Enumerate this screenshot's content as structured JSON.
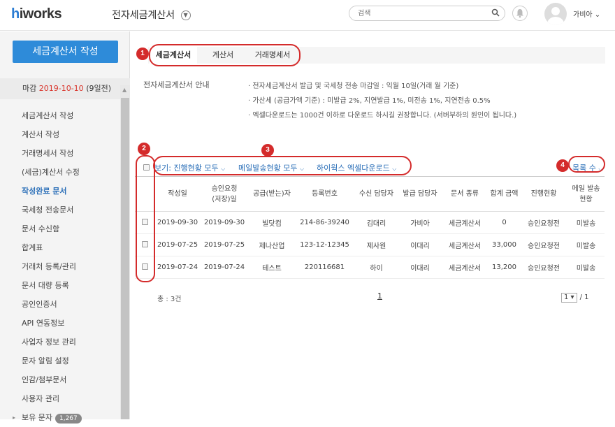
{
  "header": {
    "logo": "hiworks",
    "app_title": "전자세금계산서",
    "search_placeholder": "검색",
    "username": "가비아 ⌄"
  },
  "sidebar": {
    "compose_label": "세금계산서 작성",
    "deadline_prefix": "마감",
    "deadline_date": "2019-10-10",
    "deadline_suffix": "(9일전)",
    "items": [
      {
        "label": "세금계산서 작성"
      },
      {
        "label": "계산서 작성"
      },
      {
        "label": "거래명세서 작성"
      },
      {
        "label": "(세금)계산서 수정"
      },
      {
        "label": "작성완료 문서"
      },
      {
        "label": "국세청 전송문서"
      },
      {
        "label": "문서 수신함"
      },
      {
        "label": "합계표"
      },
      {
        "label": "거래처 등록/관리"
      },
      {
        "label": "문서 대량 등록"
      },
      {
        "label": "공인인증서"
      },
      {
        "label": "API 연동정보"
      },
      {
        "label": "사업자 정보 관리"
      },
      {
        "label": "문자 알림 설정"
      },
      {
        "label": "인감/첨부문서"
      },
      {
        "label": "사용자 관리"
      },
      {
        "label": "보유 문자",
        "badge": "1,267"
      }
    ]
  },
  "tabs": [
    "세금계산서",
    "계산서",
    "거래명세서"
  ],
  "info": {
    "label": "전자세금계산서 안내",
    "lines": [
      "· 전자세금계산서 발급 및 국세청 전송 마감일 : 익월 10일(거래 월 기준)",
      "· 가산세 (공급가액 기준) : 미발급 2%, 지연발급 1%, 미전송 1%, 지연전송 0.5%",
      "· 엑셀다운로드는 1000건 이하로 다운로드 하시길 권장합니다. (서버부하의 원인이 됩니다.)"
    ]
  },
  "filters": {
    "view": "보기: 진행현황 모두",
    "mail": "메일발송현황 모두",
    "excel": "하이웍스 엑셀다운로드",
    "list_count": "목록 수"
  },
  "table": {
    "headers": [
      "작성일",
      "승인요청\n(저장)일",
      "공급(받는)자",
      "등록번호",
      "수신 담당자",
      "발급 담당자",
      "문서 종류",
      "합계 금액",
      "진행현황",
      "메일 발송\n현황"
    ],
    "rows": [
      [
        "2019-09-30",
        "2019-09-30",
        "빌닷컴",
        "214-86-39240",
        "김대리",
        "가비아",
        "세금계산서",
        "0",
        "승인요청전",
        "미발송"
      ],
      [
        "2019-07-25",
        "2019-07-25",
        "제나산업",
        "123-12-12345",
        "제사원",
        "이대리",
        "세금계산서",
        "33,000",
        "승인요청전",
        "미발송"
      ],
      [
        "2019-07-24",
        "2019-07-24",
        "테스트",
        "220116681",
        "하이",
        "이대리",
        "세금계산서",
        "13,200",
        "승인요청전",
        "미발송"
      ]
    ]
  },
  "footer": {
    "total": "총 : 3건",
    "current_page": "1",
    "page_select": "1 ▾",
    "page_total": "/ 1"
  },
  "annotations": [
    "1",
    "2",
    "3",
    "4"
  ],
  "colors": {
    "accent": "#2e8bd9",
    "annotation": "#d42b2b",
    "deadline": "#d9342b"
  }
}
